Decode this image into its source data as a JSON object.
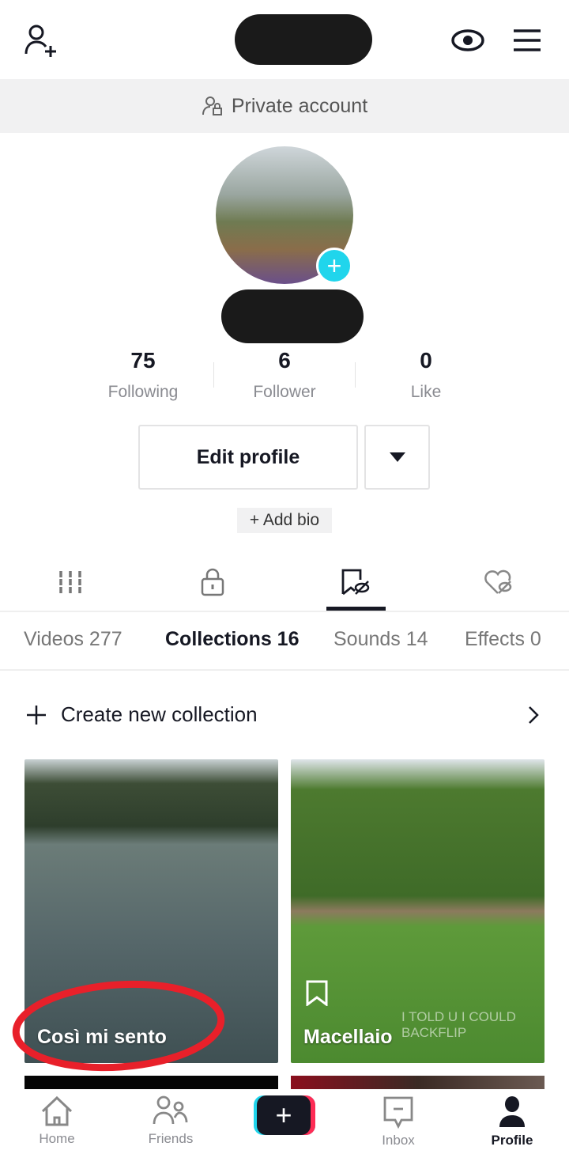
{
  "header": {
    "private_label": "Private account",
    "add_user_icon": "person-plus-icon",
    "eye_icon": "eye-icon",
    "menu_icon": "hamburger-icon"
  },
  "profile": {
    "stats": [
      {
        "value": "75",
        "label": "Following"
      },
      {
        "value": "6",
        "label": "Follower"
      },
      {
        "value": "0",
        "label": "Like"
      }
    ],
    "edit_label": "Edit profile",
    "add_bio_label": "+ Add bio"
  },
  "content_tabs": [
    "grid-icon",
    "lock-icon",
    "bookmark-hidden-icon",
    "heart-hidden-icon"
  ],
  "sub_tabs": [
    "Videos 277",
    "Collections 16",
    "Sounds 14",
    "Effects 0"
  ],
  "create_collection": "Create new collection",
  "collections": [
    {
      "title": "Così mi sento"
    },
    {
      "title": "Macellaio",
      "overlay": "I TOLD U I COULD BACKFLIP"
    }
  ],
  "nav": [
    {
      "label": "Home"
    },
    {
      "label": "Friends"
    },
    {
      "label": "Inbox"
    },
    {
      "label": "Profile"
    }
  ],
  "colors": {
    "accent": "#20d5ec",
    "pink": "#fe2c55",
    "annotation": "#e8202a"
  }
}
